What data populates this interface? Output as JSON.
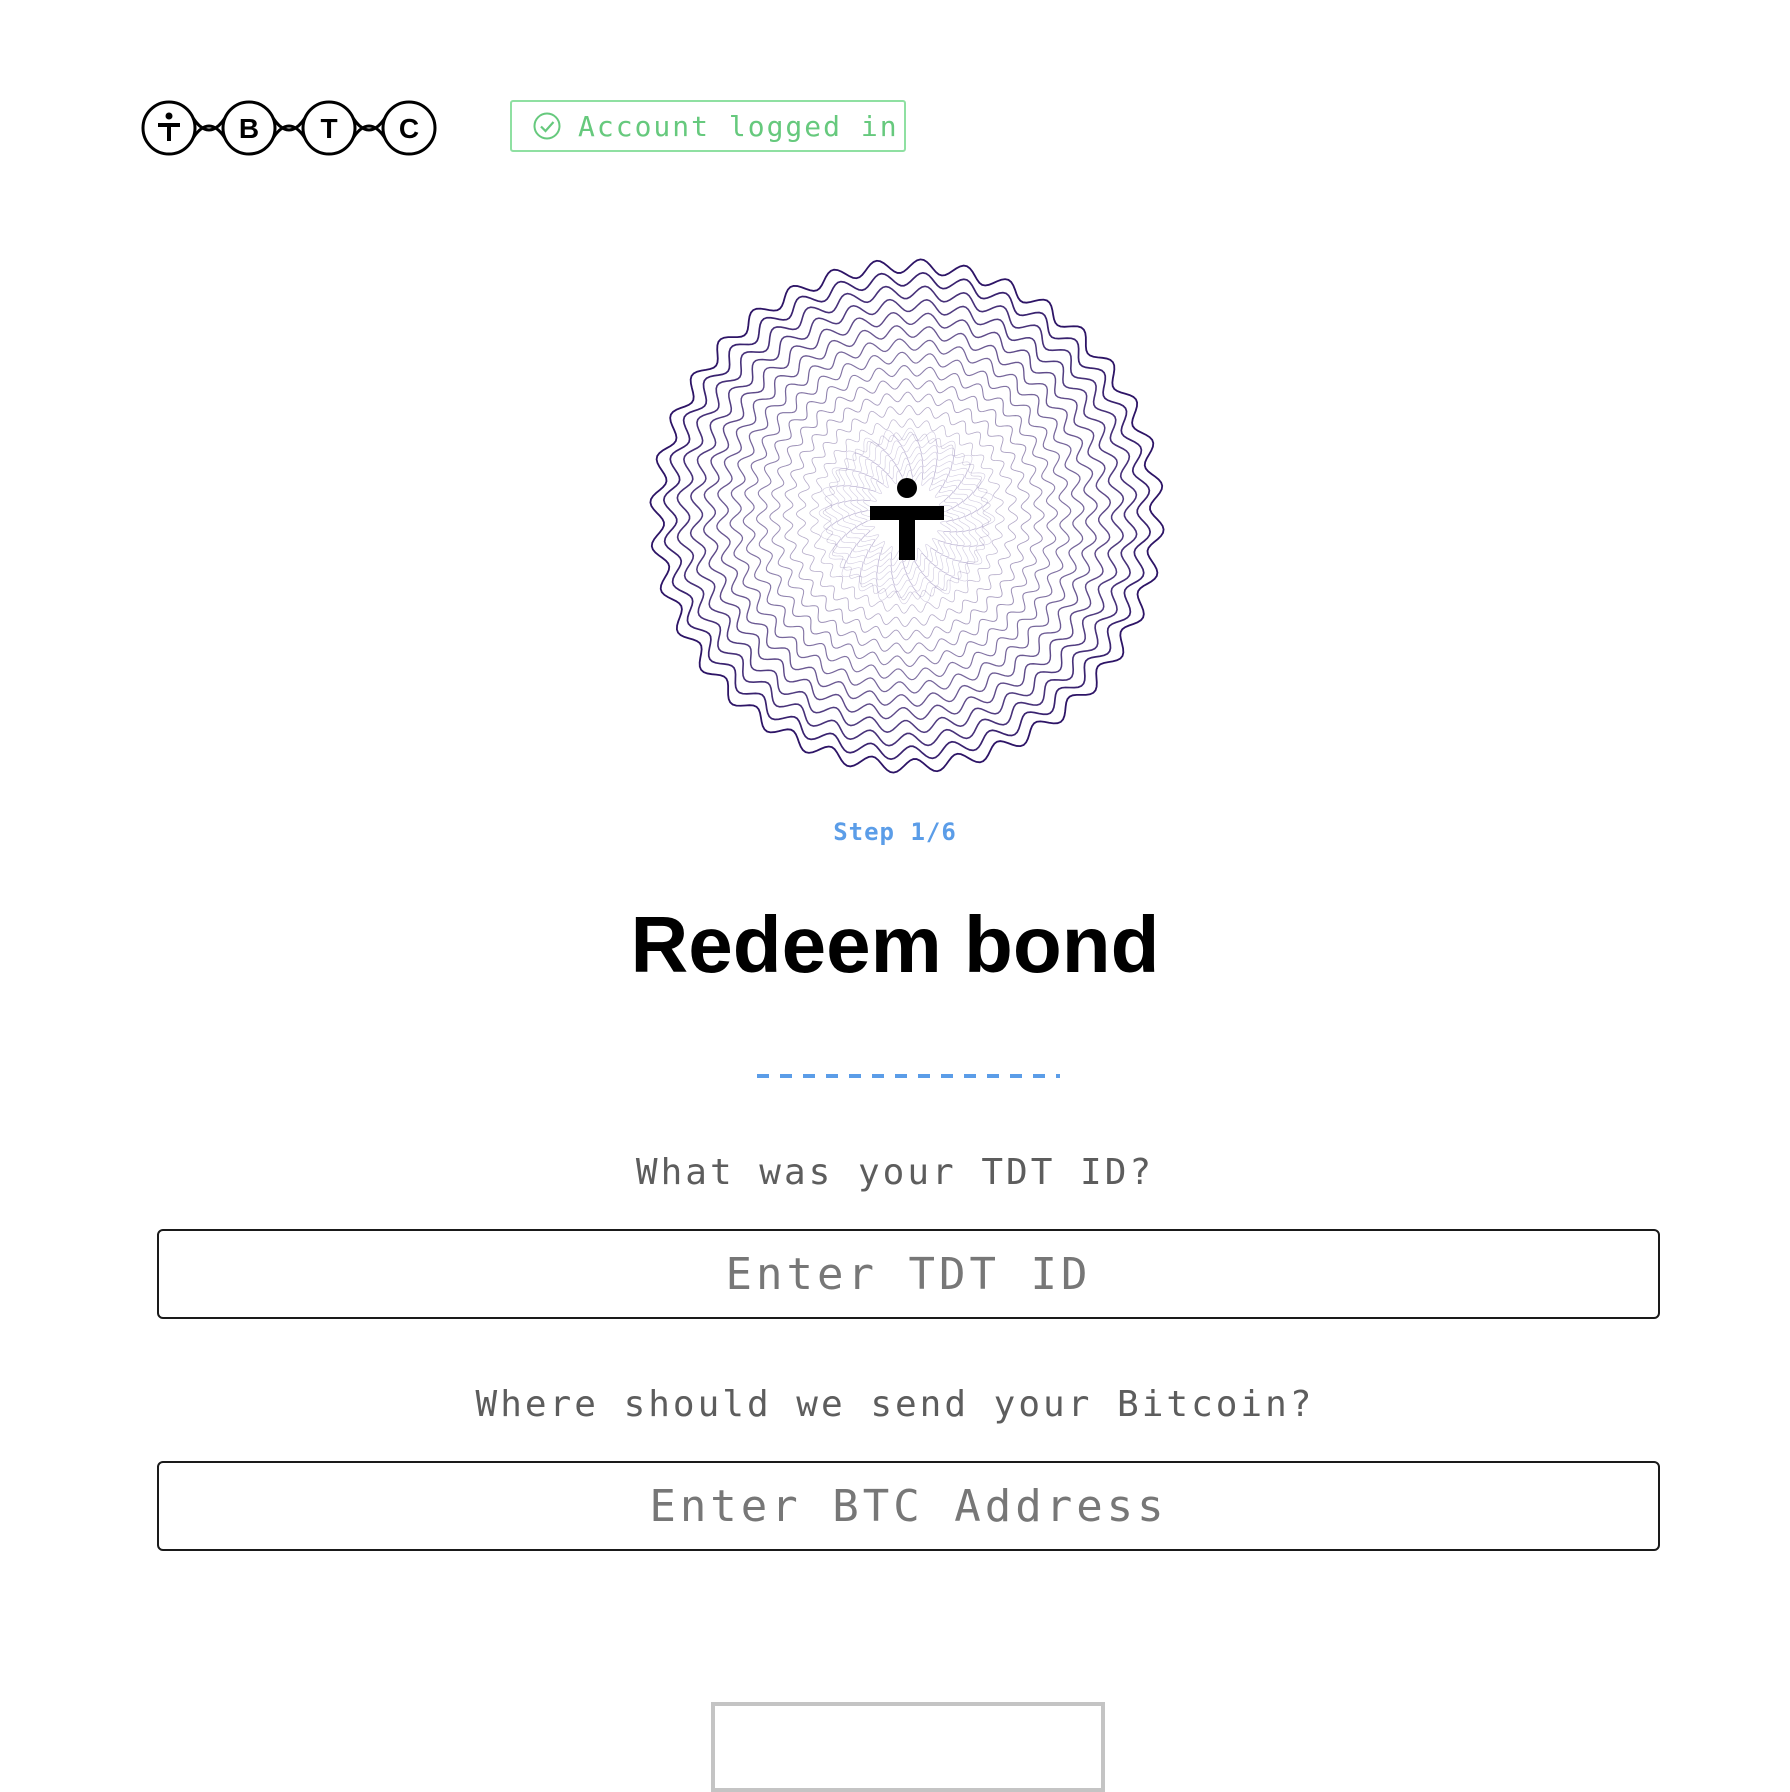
{
  "header": {
    "logo_letters": [
      "B",
      "T",
      "C"
    ],
    "status_badge": {
      "text": "Account logged in",
      "icon": "check-circle-icon",
      "color": "#66c97d"
    }
  },
  "hero": {
    "icon": "tbtc-mark-icon",
    "ring_color": "#2d1466"
  },
  "step": {
    "label": "Step 1/6"
  },
  "main": {
    "title": "Redeem bond",
    "divider": "-------------",
    "tdt_question": "What was your TDT ID?",
    "tdt_placeholder": "Enter TDT ID",
    "btc_question": "Where should we send your Bitcoin?",
    "btc_placeholder": "Enter BTC Address"
  },
  "colors": {
    "accent_blue": "#5b9de8",
    "success_green": "#66c97d",
    "text_gray": "#5d5d5d"
  }
}
